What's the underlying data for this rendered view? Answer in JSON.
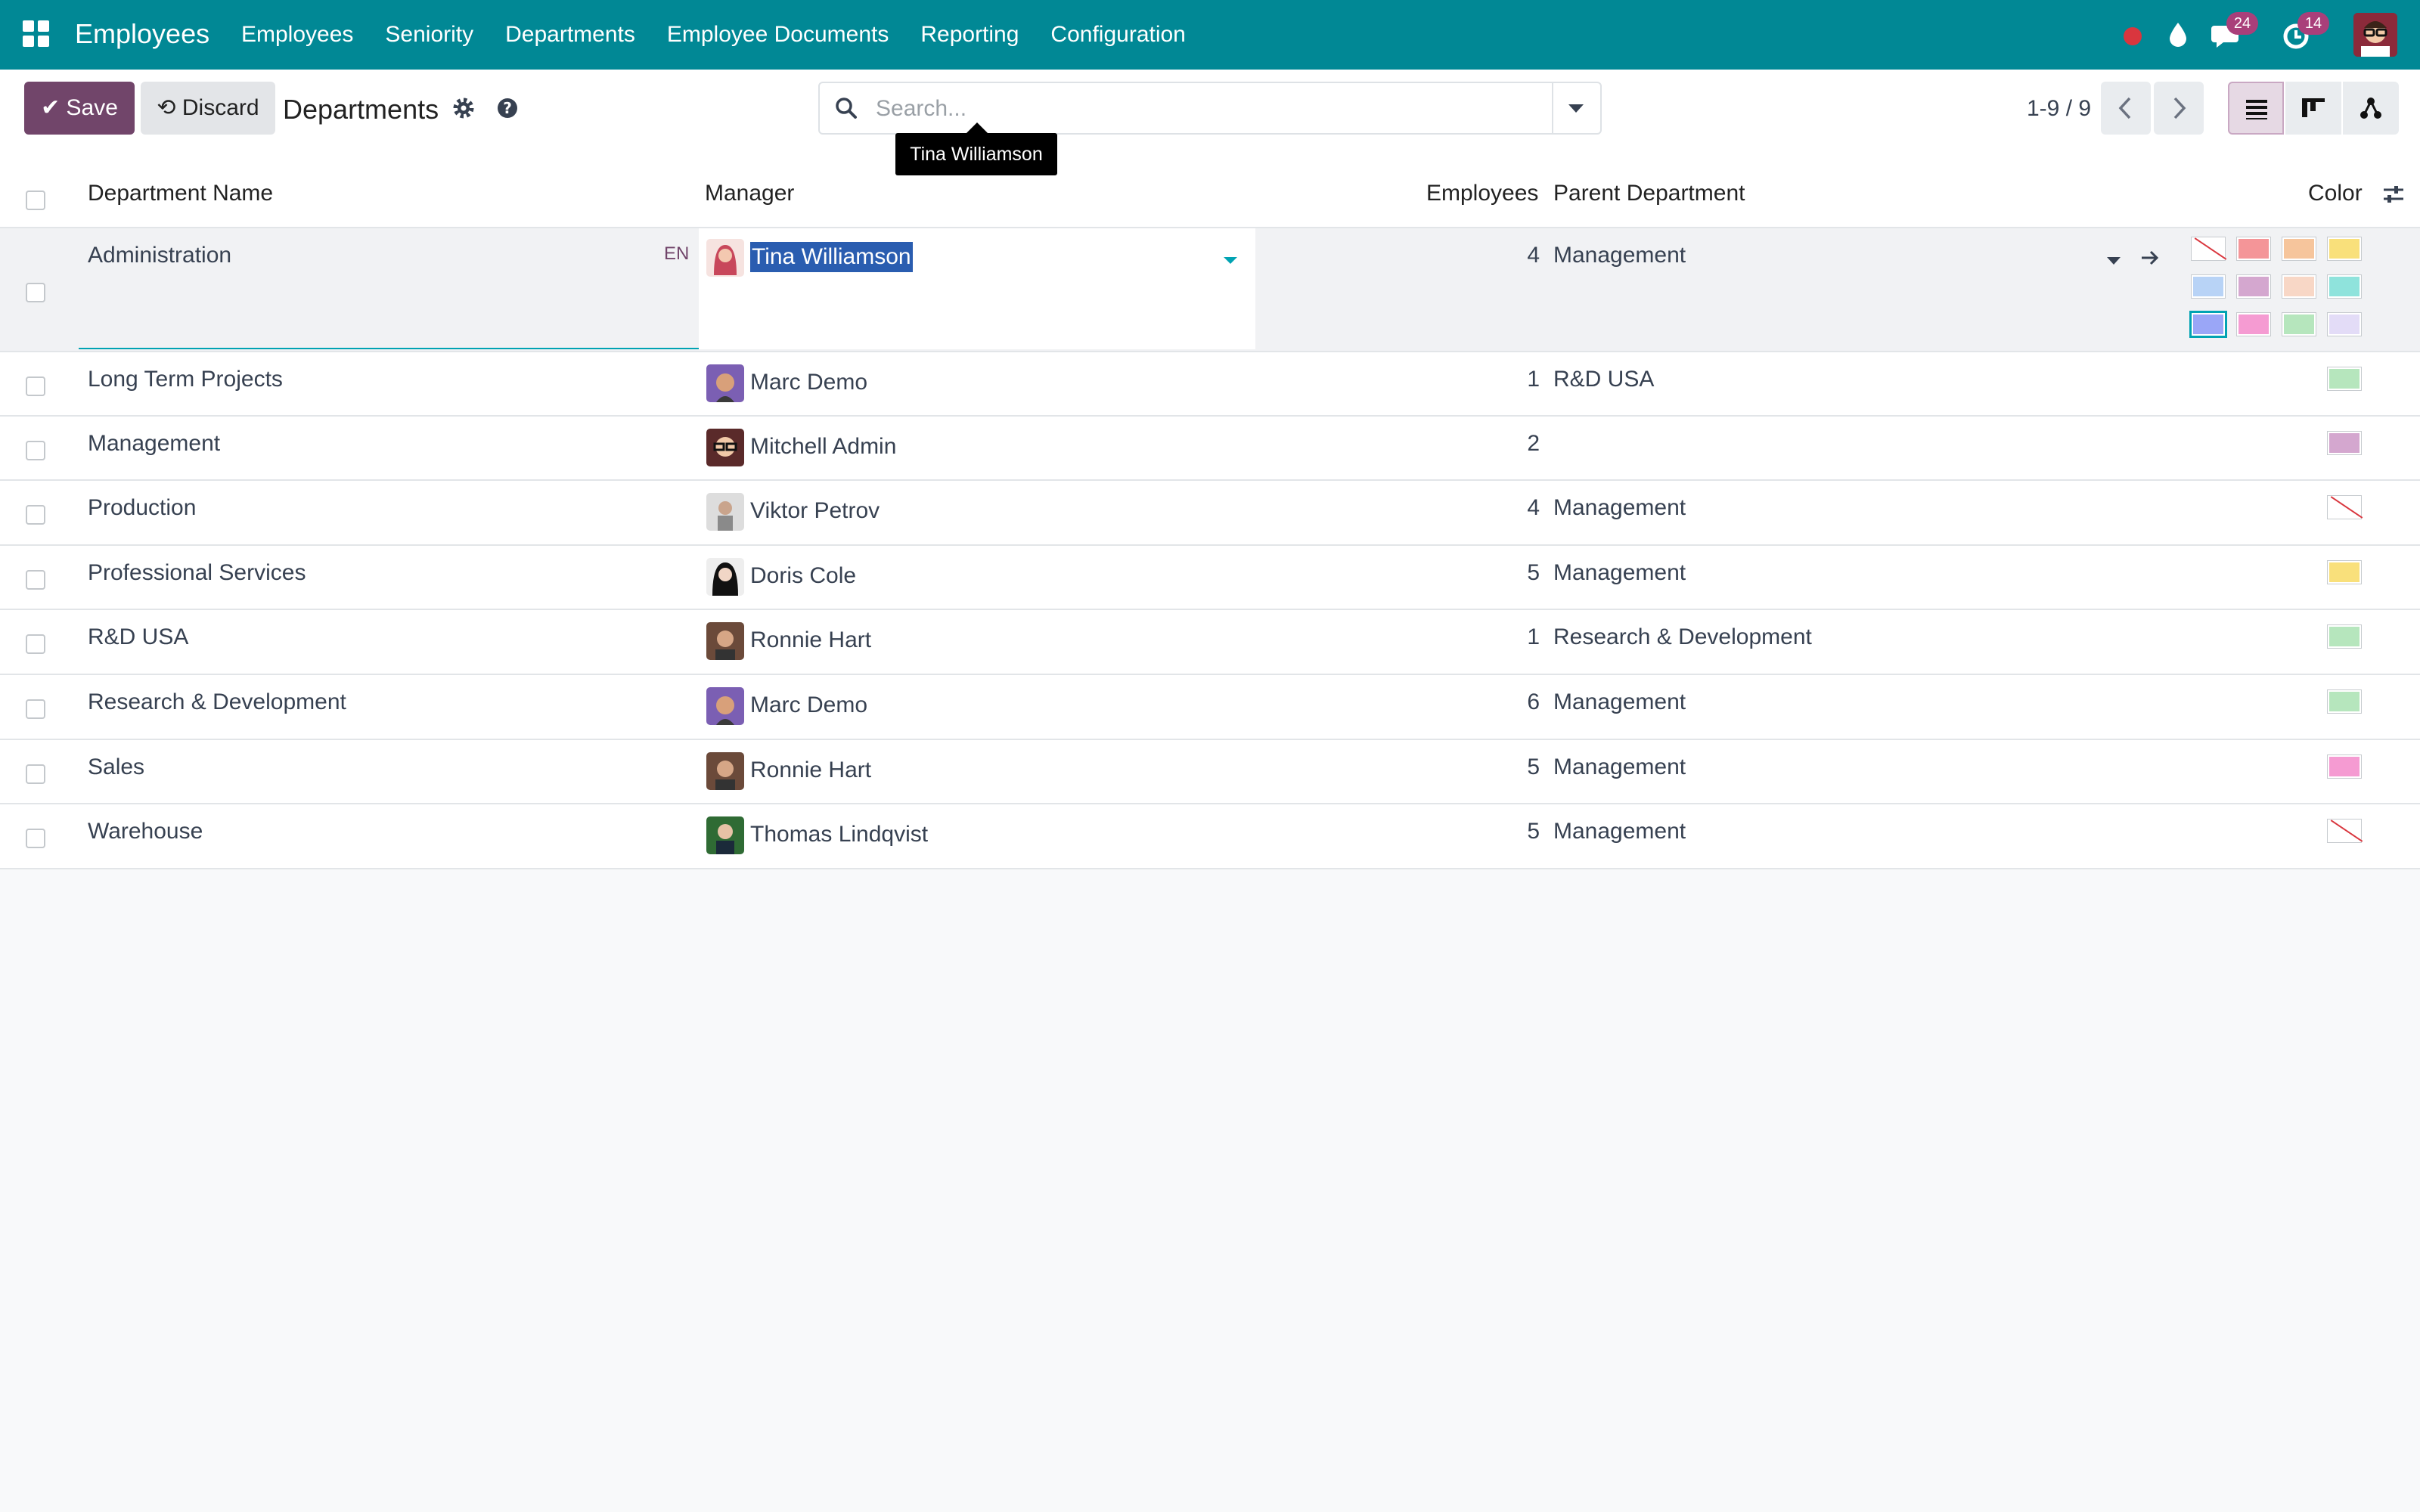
{
  "navbar": {
    "app_name": "Employees",
    "menu": [
      "Employees",
      "Seniority",
      "Departments",
      "Employee Documents",
      "Reporting",
      "Configuration"
    ],
    "messages_count": "24",
    "activities_count": "14",
    "icons": [
      "apps-icon",
      "record-icon",
      "debug-drop-icon",
      "chat-icon",
      "clock-icon",
      "user-avatar"
    ]
  },
  "control_panel": {
    "save_label": "Save",
    "discard_label": "Discard",
    "title": "Departments",
    "search_placeholder": "Search...",
    "pager": "1-9 / 9",
    "views": [
      "list-view",
      "kanban-view",
      "hierarchy-view"
    ]
  },
  "table": {
    "headers": {
      "name": "Department Name",
      "manager": "Manager",
      "employees": "Employees",
      "parent": "Parent Department",
      "color": "Color"
    },
    "editing_row": {
      "name": "Administration",
      "lang": "EN",
      "manager": "Tina Williamson",
      "tooltip": "Tina Williamson",
      "employees": "4",
      "parent": "Management"
    },
    "rows": [
      {
        "name": "Long Term Projects",
        "manager": "Marc Demo",
        "employees": "1",
        "parent": "R&D USA",
        "color": "#b6e6bd"
      },
      {
        "name": "Management",
        "manager": "Mitchell Admin",
        "employees": "2",
        "parent": "",
        "color": "#d4a7cf"
      },
      {
        "name": "Production",
        "manager": "Viktor Petrov",
        "employees": "4",
        "parent": "Management",
        "color": "none"
      },
      {
        "name": "Professional Services",
        "manager": "Doris Cole",
        "employees": "5",
        "parent": "Management",
        "color": "#f9e07b"
      },
      {
        "name": "R&D USA",
        "manager": "Ronnie Hart",
        "employees": "1",
        "parent": "Research & Development",
        "color": "#b6e6bd"
      },
      {
        "name": "Research & Development",
        "manager": "Marc Demo",
        "employees": "6",
        "parent": "Management",
        "color": "#b6e6bd"
      },
      {
        "name": "Sales",
        "manager": "Ronnie Hart",
        "employees": "5",
        "parent": "Management",
        "color": "#f59bd2"
      },
      {
        "name": "Warehouse",
        "manager": "Thomas Lindqvist",
        "employees": "5",
        "parent": "Management",
        "color": "none"
      }
    ]
  },
  "color_picker": {
    "colors": [
      "none",
      "#f49598",
      "#f6c59c",
      "#f9e07b",
      "#b8d3f6",
      "#d4a7cf",
      "#f8d7c6",
      "#8fe3dc",
      "#9aa6f7",
      "#f59bd2",
      "#b6e6bd",
      "#e3dcf7"
    ],
    "selected_index": 8
  },
  "theme": {
    "primary": "#71456a",
    "navbar": "#018895",
    "accent": "#01a3b3"
  }
}
